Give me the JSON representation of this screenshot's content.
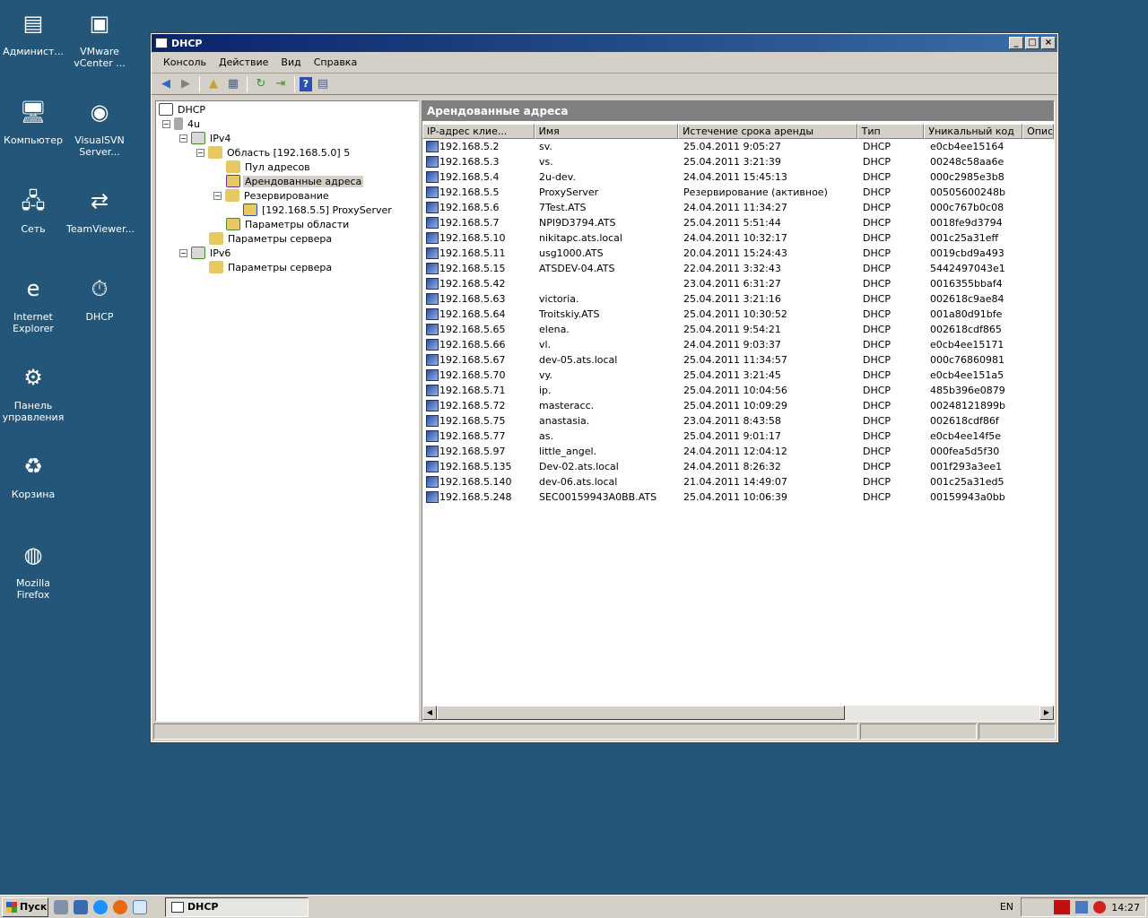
{
  "desktop": {
    "icons": [
      {
        "label": "Админист...",
        "color": "#c8a030"
      },
      {
        "label": "VMware vCenter ...",
        "color": "#e07a10"
      },
      {
        "label": "Компьютер",
        "color": "#3a7bd5"
      },
      {
        "label": "VisualSVN Server...",
        "color": "#d02020"
      },
      {
        "label": "Сеть",
        "color": "#2a8ad8"
      },
      {
        "label": "TeamViewer...",
        "color": "#0e6bd6"
      },
      {
        "label": "Internet Explorer",
        "color": "#1e90ff"
      },
      {
        "label": "DHCP",
        "color": "#c8a030"
      },
      {
        "label": "Панель управления",
        "color": "#5a8fd0"
      },
      {
        "label": "Корзина",
        "color": "#a0b8d0"
      },
      {
        "label": "Mozilla Firefox",
        "color": "#e86a10"
      }
    ]
  },
  "window": {
    "title": "DHCP",
    "menu": [
      "Консоль",
      "Действие",
      "Вид",
      "Справка"
    ]
  },
  "tree": {
    "root": "DHCP",
    "server": "4u",
    "ipv4": "IPv4",
    "scope": "Область [192.168.5.0] 5",
    "pool": "Пул адресов",
    "leases": "Арендованные адреса",
    "reservations": "Резервирование",
    "reservation_item": "[192.168.5.5] ProxyServer",
    "scope_options": "Параметры области",
    "server_options4": "Параметры сервера",
    "ipv6": "IPv6",
    "server_options6": "Параметры сервера"
  },
  "panel": {
    "header": "Арендованные адреса",
    "columns": [
      "IP-адрес клие...",
      "Имя",
      "Истечение срока аренды",
      "Тип",
      "Уникальный код",
      "Описа"
    ],
    "rows": [
      [
        "192.168.5.2",
        "sv.",
        "25.04.2011 9:05:27",
        "DHCP",
        "e0cb4ee15164"
      ],
      [
        "192.168.5.3",
        "vs.",
        "25.04.2011 3:21:39",
        "DHCP",
        "00248c58aa6e"
      ],
      [
        "192.168.5.4",
        "2u-dev.",
        "24.04.2011 15:45:13",
        "DHCP",
        "000c2985e3b8"
      ],
      [
        "192.168.5.5",
        "ProxyServer",
        "Резервирование (активное)",
        "DHCP",
        "00505600248b"
      ],
      [
        "192.168.5.6",
        "7Test.ATS",
        "24.04.2011 11:34:27",
        "DHCP",
        "000c767b0c08"
      ],
      [
        "192.168.5.7",
        "NPI9D3794.ATS",
        "25.04.2011 5:51:44",
        "DHCP",
        "0018fe9d3794"
      ],
      [
        "192.168.5.10",
        "nikitapc.ats.local",
        "24.04.2011 10:32:17",
        "DHCP",
        "001c25a31eff"
      ],
      [
        "192.168.5.11",
        "usg1000.ATS",
        "20.04.2011 15:24:43",
        "DHCP",
        "0019cbd9a493"
      ],
      [
        "192.168.5.15",
        "ATSDEV-04.ATS",
        "22.04.2011 3:32:43",
        "DHCP",
        "5442497043e1"
      ],
      [
        "192.168.5.42",
        "",
        "23.04.2011 6:31:27",
        "DHCP",
        "0016355bbaf4"
      ],
      [
        "192.168.5.63",
        "victoria.",
        "25.04.2011 3:21:16",
        "DHCP",
        "002618c9ae84"
      ],
      [
        "192.168.5.64",
        "Troitskiy.ATS",
        "25.04.2011 10:30:52",
        "DHCP",
        "001a80d91bfe"
      ],
      [
        "192.168.5.65",
        "elena.",
        "25.04.2011 9:54:21",
        "DHCP",
        "002618cdf865"
      ],
      [
        "192.168.5.66",
        "vl.",
        "24.04.2011 9:03:37",
        "DHCP",
        "e0cb4ee15171"
      ],
      [
        "192.168.5.67",
        "dev-05.ats.local",
        "25.04.2011 11:34:57",
        "DHCP",
        "000c76860981"
      ],
      [
        "192.168.5.70",
        "vy.",
        "25.04.2011 3:21:45",
        "DHCP",
        "e0cb4ee151a5"
      ],
      [
        "192.168.5.71",
        "ip.",
        "25.04.2011 10:04:56",
        "DHCP",
        "485b396e0879"
      ],
      [
        "192.168.5.72",
        "masteracc.",
        "25.04.2011 10:09:29",
        "DHCP",
        "00248121899b"
      ],
      [
        "192.168.5.75",
        "anastasia.",
        "23.04.2011 8:43:58",
        "DHCP",
        "002618cdf86f"
      ],
      [
        "192.168.5.77",
        "as.",
        "25.04.2011 9:01:17",
        "DHCP",
        "e0cb4ee14f5e"
      ],
      [
        "192.168.5.97",
        "little_angel.",
        "24.04.2011 12:04:12",
        "DHCP",
        "000fea5d5f30"
      ],
      [
        "192.168.5.135",
        "Dev-02.ats.local",
        "24.04.2011 8:26:32",
        "DHCP",
        "001f293a3ee1"
      ],
      [
        "192.168.5.140",
        "dev-06.ats.local",
        "21.04.2011 14:49:07",
        "DHCP",
        "001c25a31ed5"
      ],
      [
        "192.168.5.248",
        "SEC00159943A0BB.ATS",
        "25.04.2011 10:06:39",
        "DHCP",
        "00159943a0bb"
      ]
    ]
  },
  "taskbar": {
    "start": "Пуск",
    "task": "DHCP",
    "lang": "EN",
    "clock": "14:27"
  }
}
